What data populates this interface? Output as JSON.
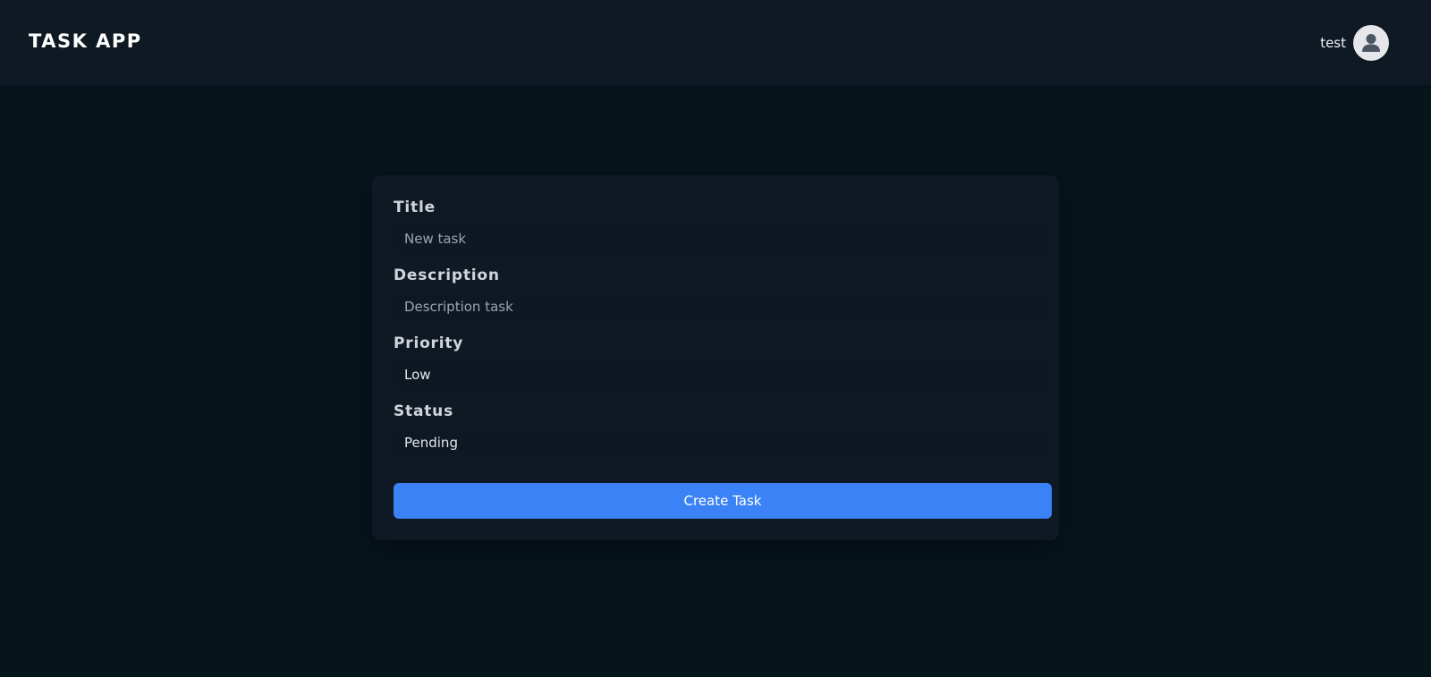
{
  "app": {
    "title": "TASK APP"
  },
  "user": {
    "name": "test",
    "avatar_icon": "user-avatar-icon"
  },
  "form": {
    "title": {
      "label": "Title",
      "placeholder": "New task"
    },
    "description": {
      "label": "Description",
      "placeholder": "Description task"
    },
    "priority": {
      "label": "Priority",
      "value": "Low"
    },
    "status": {
      "label": "Status",
      "value": "Pending"
    },
    "submit_label": "Create Task"
  },
  "colors": {
    "background": "#06141c",
    "surface": "#0f1923",
    "accent": "#3b82f6"
  }
}
